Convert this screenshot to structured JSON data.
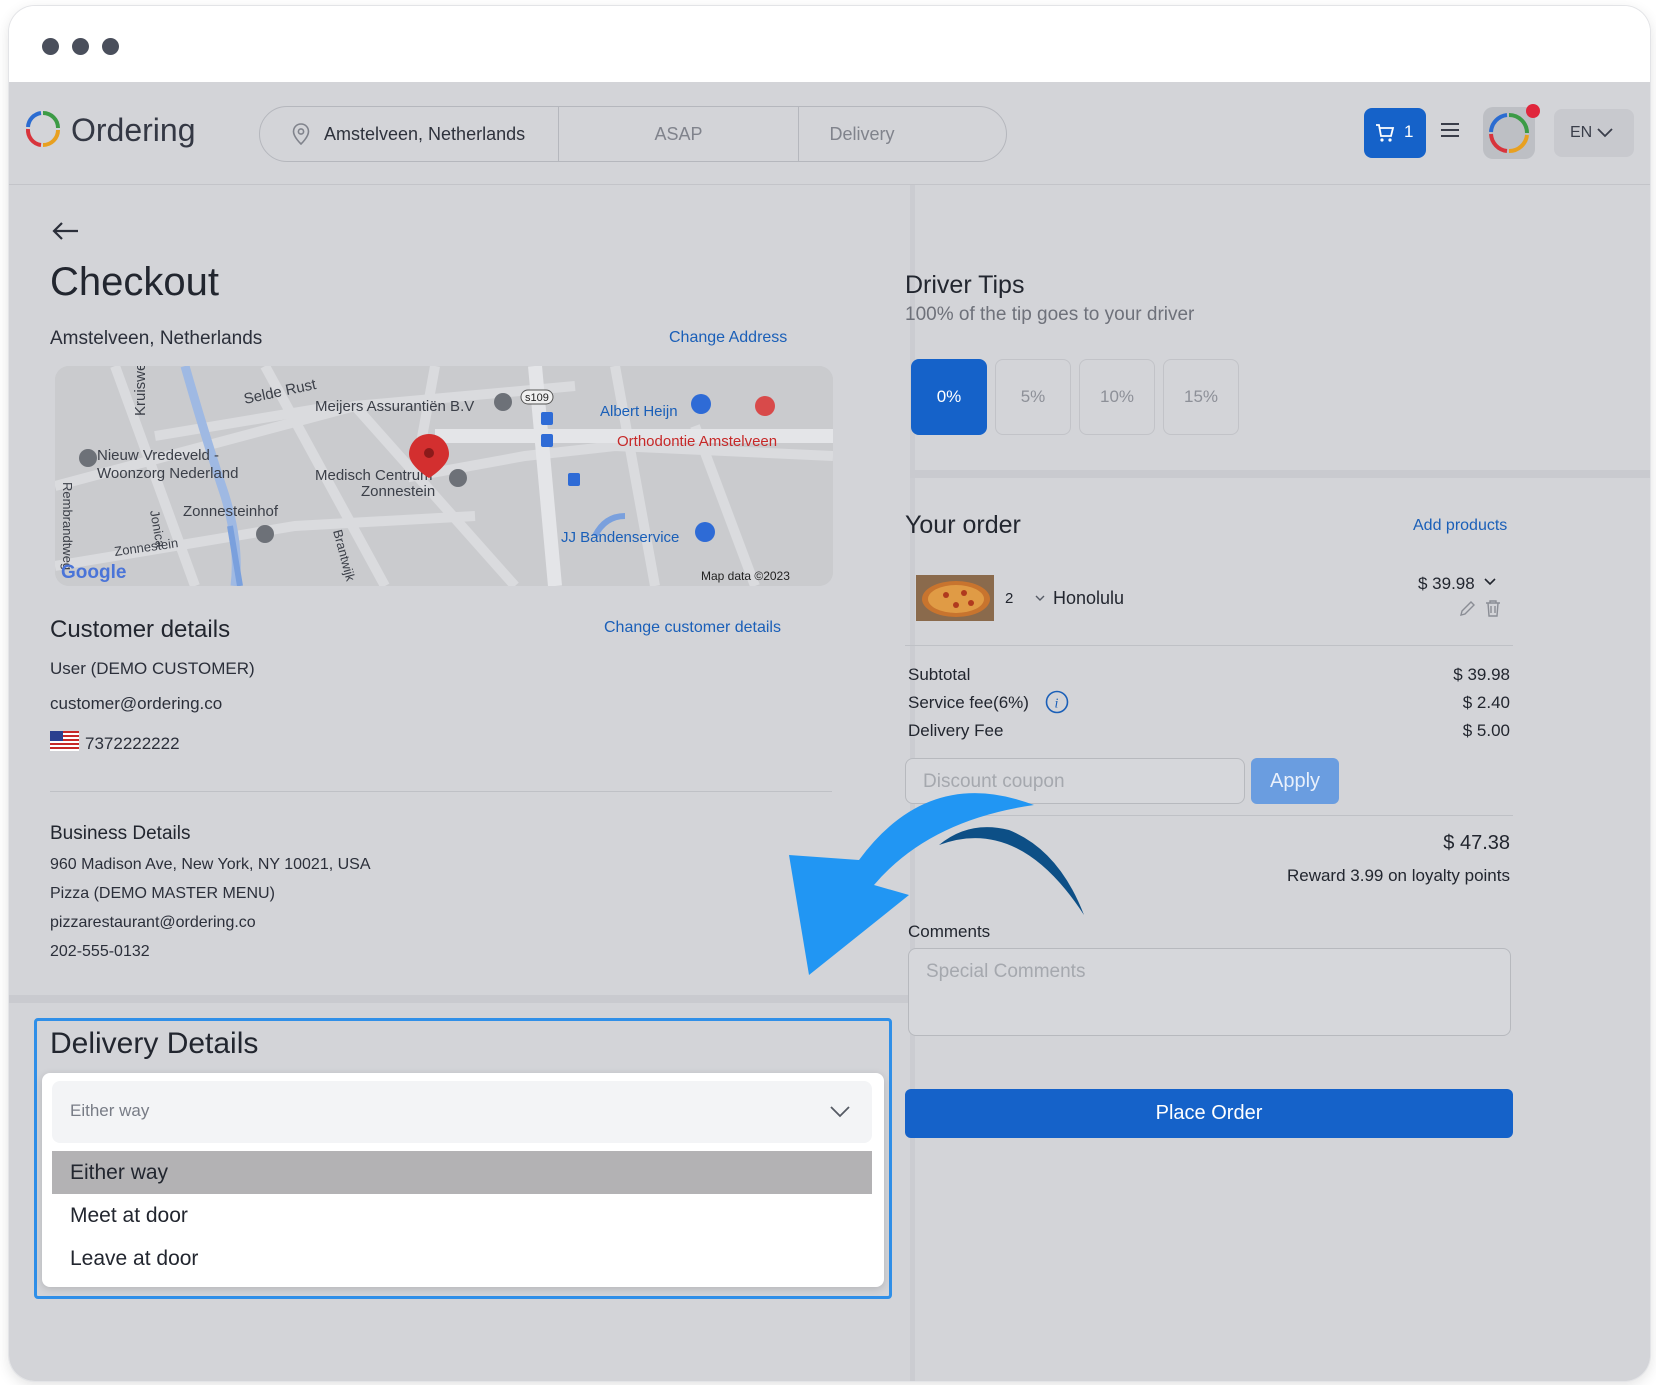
{
  "header": {
    "logo_text": "Ordering",
    "location": "Amstelveen, Netherlands",
    "time": "ASAP",
    "order_type": "Delivery",
    "cart_count": "1",
    "language": "EN"
  },
  "checkout": {
    "title": "Checkout",
    "address": "Amstelveen, Netherlands",
    "change_address": "Change Address",
    "map": {
      "labels": [
        "Kruisweer",
        "Selde Rust",
        "Meijers Assurantiën B.V",
        "s109",
        "Albert Heijn",
        "Orthodontie Amstelveen",
        "Nieuw Vredeveld -",
        "Woonzorg Nederland",
        "Medisch Centrum",
        "Zonnestein",
        "Zonnesteinhof",
        "Jonica",
        "Rembrandtweg",
        "Brantwijk",
        "JJ Bandenservice",
        "Zonnestein"
      ],
      "google": "Google",
      "copyright": "Map data ©2023"
    },
    "customer": {
      "title": "Customer details",
      "change": "Change customer details",
      "name": "User (DEMO CUSTOMER)",
      "email": "customer@ordering.co",
      "phone": "7372222222"
    },
    "business": {
      "title": "Business Details",
      "address": "960 Madison Ave, New York, NY 10021, USA",
      "name": "Pizza (DEMO MASTER MENU)",
      "email": "pizzarestaurant@ordering.co",
      "phone": "202-555-0132"
    },
    "delivery": {
      "title": "Delivery Details",
      "selected": "Either way",
      "options": [
        "Either way",
        "Meet at door",
        "Leave at door"
      ]
    }
  },
  "tips": {
    "title": "Driver Tips",
    "subtitle": "100% of the tip goes to your driver",
    "options": [
      "0%",
      "5%",
      "10%",
      "15%"
    ]
  },
  "order": {
    "title": "Your order",
    "add_products": "Add products",
    "item": {
      "qty": "2",
      "name": "Honolulu",
      "price": "$ 39.98"
    },
    "subtotal_label": "Subtotal",
    "subtotal": "$ 39.98",
    "service_label": "Service fee(6%)",
    "service": "$ 2.40",
    "delivery_label": "Delivery Fee",
    "delivery": "$ 5.00",
    "coupon_placeholder": "Discount coupon",
    "apply": "Apply",
    "total": "$ 47.38",
    "reward": "Reward 3.99 on loyalty points",
    "comments_label": "Comments",
    "comments_placeholder": "Special Comments",
    "place_order": "Place Order"
  },
  "colors": {
    "accent": "#1562c9",
    "highlight_border": "#2f8fe8",
    "arrow": "#2196f3",
    "map_red": "#d32f2f"
  }
}
